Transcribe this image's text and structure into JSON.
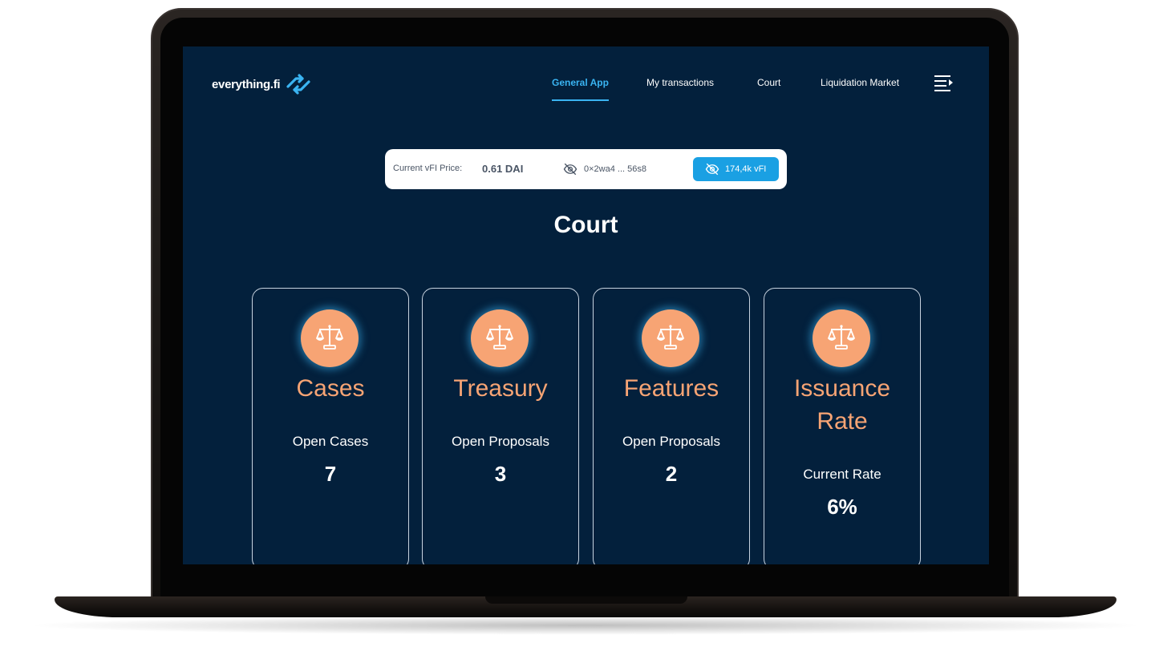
{
  "brand": {
    "name": "everything.fi",
    "accent": "#3ab4f2",
    "orange": "#f7a474",
    "background": "#03203c"
  },
  "nav": {
    "items": [
      {
        "label": "General App",
        "active": true
      },
      {
        "label": "My transactions",
        "active": false
      },
      {
        "label": "Court",
        "active": false
      },
      {
        "label": "Liquidation Market",
        "active": false
      }
    ],
    "menu_icon": "menu-icon"
  },
  "info_bar": {
    "price_label": "Current vFI Price:",
    "price_value": "0.61 DAI",
    "address": "0×2wa4 ... 56s8",
    "address_icon": "eye-off-icon",
    "balance": "174,4k vFI",
    "balance_icon": "eye-off-icon"
  },
  "page": {
    "title": "Court"
  },
  "cards": [
    {
      "title": "Cases",
      "subtitle": "Open Cases",
      "value": "7",
      "icon": "scales-icon"
    },
    {
      "title": "Treasury",
      "subtitle": "Open Proposals",
      "value": "3",
      "icon": "scales-icon"
    },
    {
      "title": "Features",
      "subtitle": "Open Proposals",
      "value": "2",
      "icon": "scales-icon"
    },
    {
      "title": "Issuance Rate",
      "subtitle": "Current Rate",
      "value": "6%",
      "icon": "scales-icon"
    }
  ]
}
